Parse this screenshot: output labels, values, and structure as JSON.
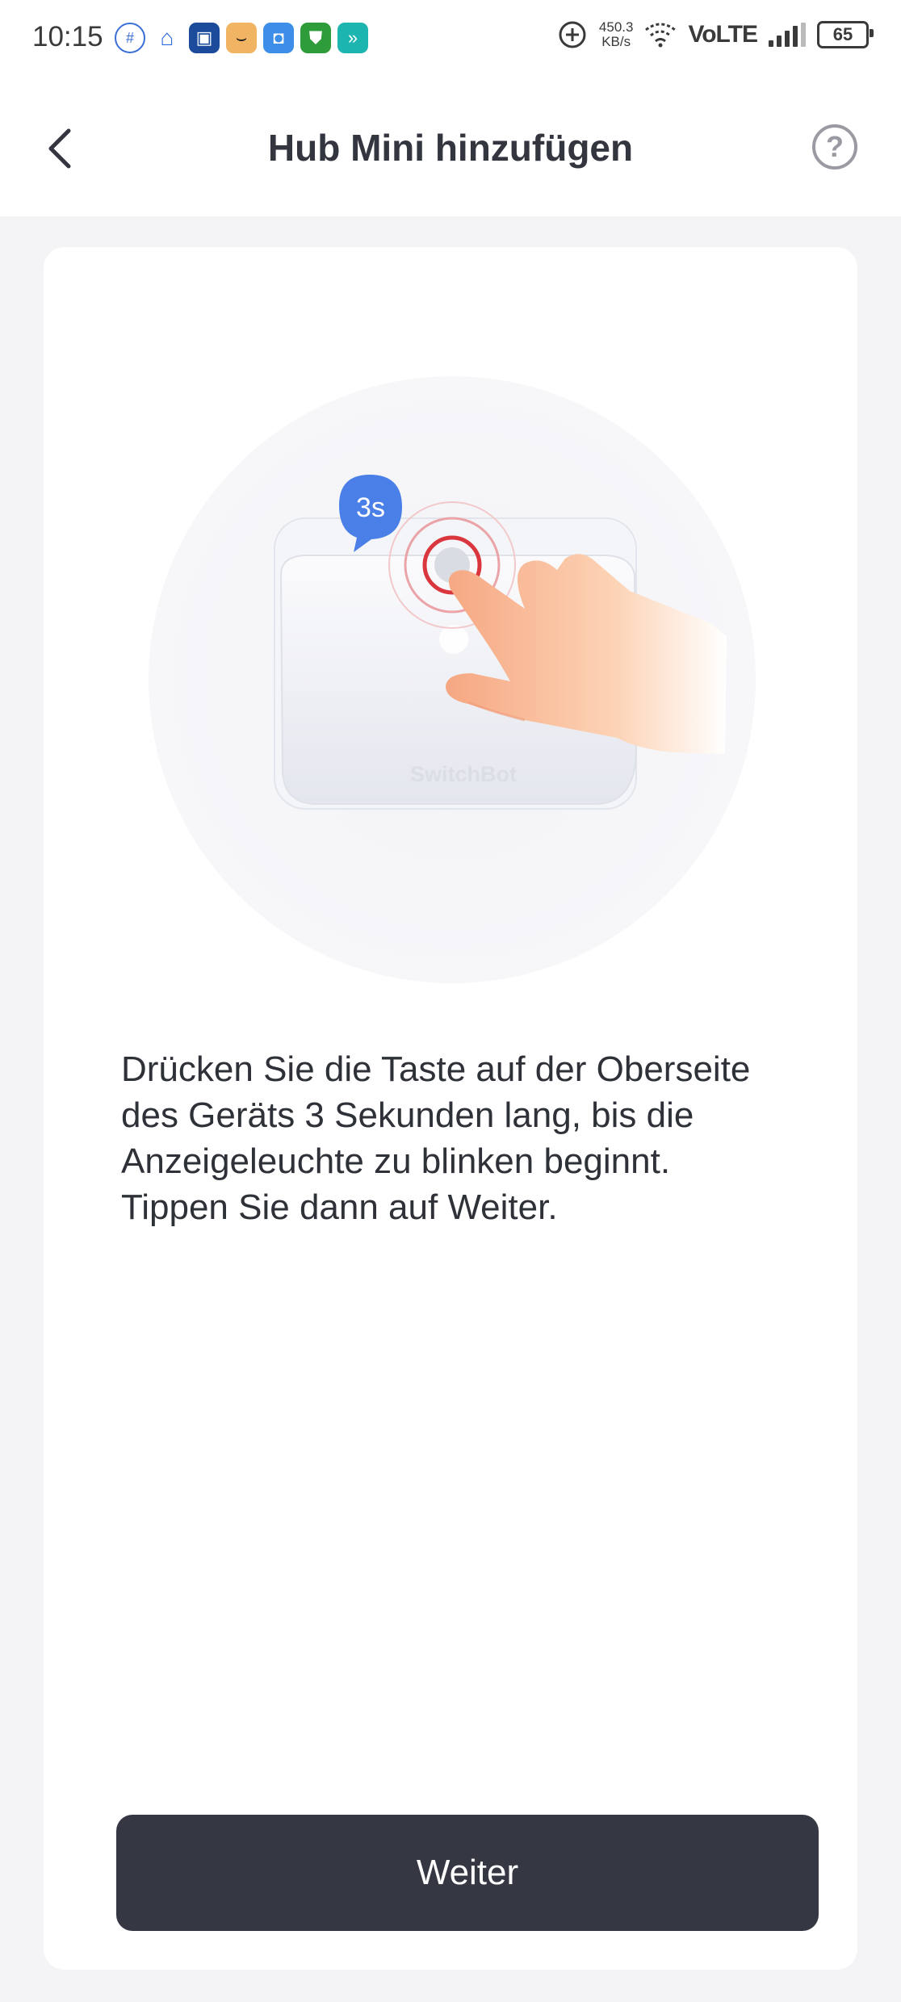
{
  "status_bar": {
    "time": "10:15",
    "net_speed_value": "450.3",
    "net_speed_unit": "KB/s",
    "network_label": "VoLTE",
    "battery": "65"
  },
  "header": {
    "title": "Hub Mini hinzufügen",
    "help_icon": "?"
  },
  "illustration": {
    "badge": "3s",
    "brand": "SwitchBot"
  },
  "instruction": "Drücken Sie die Taste auf der Oberseite des Geräts 3 Sekunden lang, bis die Anzeigeleuchte zu blinken beginnt. Tippen Sie dann auf Weiter.",
  "button": {
    "label": "Weiter"
  },
  "colors": {
    "primary_button": "#353743",
    "badge": "#4a7fe8",
    "indicator_red": "#d9363e"
  }
}
